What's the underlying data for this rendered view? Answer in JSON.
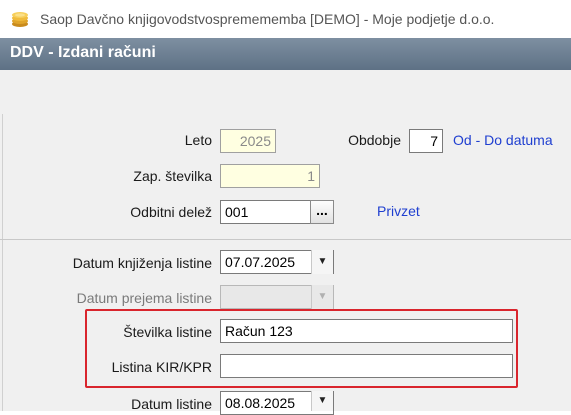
{
  "window": {
    "title": "Saop Davčno knjigovodstvospremememba [DEMO] - Moje podjetje d.o.o."
  },
  "header": {
    "title": "DDV - Izdani računi"
  },
  "form": {
    "leto": {
      "label": "Leto",
      "value": "2025"
    },
    "obdobje": {
      "label": "Obdobje",
      "value": "7",
      "link": "Od - Do datuma"
    },
    "zap_stevilka": {
      "label": "Zap. številka",
      "value": "1"
    },
    "odbitni_delez": {
      "label": "Odbitni delež",
      "value": "001",
      "button": "...",
      "link": "Privzet"
    },
    "datum_knjizenja": {
      "label": "Datum knjiženja listine",
      "value": "07.07.2025"
    },
    "datum_prejema": {
      "label": "Datum prejema listine",
      "value": ""
    },
    "stevilka_listine": {
      "label": "Številka listine",
      "value": "Račun 123"
    },
    "listina_kir": {
      "label": "Listina KIR/KPR",
      "value": ""
    },
    "datum_listine": {
      "label": "Datum listine",
      "value": "08.08.2025"
    }
  },
  "icons": {
    "app": "coins-icon",
    "dropdown": "chevron-down-icon"
  },
  "colors": {
    "header": "#6b7d90",
    "highlight_box": "#d9252d",
    "link": "#1f3fd0",
    "readonly_bg": "#ffffe1"
  }
}
